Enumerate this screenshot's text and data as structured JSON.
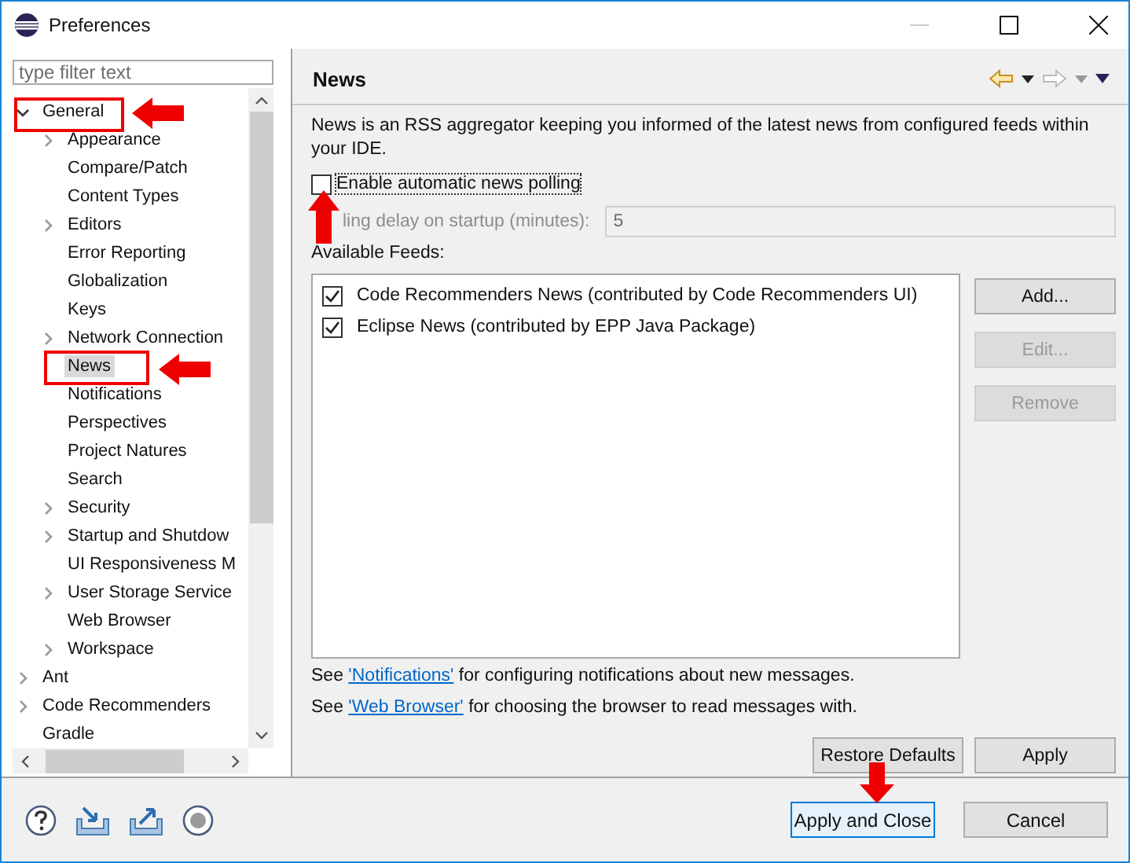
{
  "window": {
    "title": "Preferences"
  },
  "filter": {
    "placeholder": "type filter text"
  },
  "tree": [
    {
      "label": "General",
      "expanded": true,
      "selected": false,
      "children": [
        {
          "label": "Appearance",
          "expanded": false,
          "selected": false
        },
        {
          "label": "Compare/Patch",
          "selected": false
        },
        {
          "label": "Content Types",
          "selected": false
        },
        {
          "label": "Editors",
          "expanded": false,
          "selected": false
        },
        {
          "label": "Error Reporting",
          "selected": false
        },
        {
          "label": "Globalization",
          "selected": false
        },
        {
          "label": "Keys",
          "selected": false
        },
        {
          "label": "Network Connection",
          "expanded": false,
          "selected": false
        },
        {
          "label": "News",
          "selected": true
        },
        {
          "label": "Notifications",
          "selected": false
        },
        {
          "label": "Perspectives",
          "selected": false
        },
        {
          "label": "Project Natures",
          "selected": false
        },
        {
          "label": "Search",
          "selected": false
        },
        {
          "label": "Security",
          "expanded": false,
          "selected": false
        },
        {
          "label": "Startup and Shutdow",
          "expanded": false,
          "selected": false
        },
        {
          "label": "UI Responsiveness M",
          "selected": false
        },
        {
          "label": "User Storage Service",
          "expanded": false,
          "selected": false
        },
        {
          "label": "Web Browser",
          "selected": false
        },
        {
          "label": "Workspace",
          "expanded": false,
          "selected": false
        }
      ]
    },
    {
      "label": "Ant",
      "expanded": false,
      "selected": false
    },
    {
      "label": "Code Recommenders",
      "expanded": false,
      "selected": false
    },
    {
      "label": "Gradle",
      "selected": false
    }
  ],
  "page": {
    "title": "News",
    "description": "News is an RSS aggregator keeping you informed of the latest news from configured feeds within your IDE.",
    "polling": {
      "label": "Enable automatic news polling",
      "checked": false
    },
    "delay": {
      "label": "ling delay on startup (minutes):",
      "value": "5",
      "disabled": true
    },
    "feeds_label": "Available Feeds:",
    "feeds": [
      {
        "label": "Code Recommenders News (contributed by Code Recommenders UI)",
        "checked": true
      },
      {
        "label": "Eclipse News (contributed by EPP Java Package)",
        "checked": true
      }
    ],
    "feed_buttons": [
      {
        "label": "Add...",
        "disabled": false
      },
      {
        "label": "Edit...",
        "disabled": true
      },
      {
        "label": "Remove",
        "disabled": true
      }
    ],
    "links": [
      {
        "before": "See",
        "link": "'Notifications'",
        "after": "for configuring notifications about new messages."
      },
      {
        "before": "See",
        "link": "'Web Browser'",
        "after": "for choosing the browser to read messages with."
      }
    ],
    "page_buttons": [
      "Restore Defaults",
      "Apply"
    ]
  },
  "dialog_buttons": [
    {
      "label": "Apply and Close",
      "default": true
    },
    {
      "label": "Cancel",
      "default": false
    }
  ]
}
